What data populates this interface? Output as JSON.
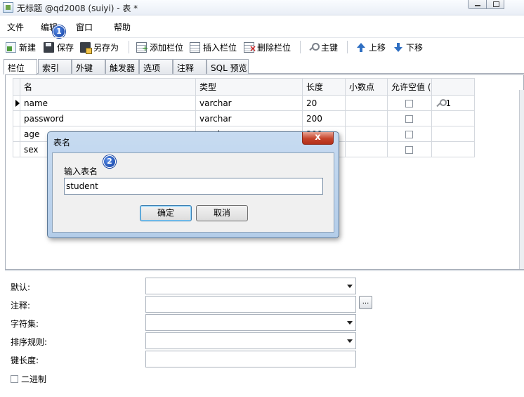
{
  "window": {
    "title": "无标题 @qd2008 (suiyi) - 表 *"
  },
  "menu": [
    "文件",
    "编辑",
    "窗口",
    "帮助"
  ],
  "toolbar": {
    "new": "新建",
    "save": "保存",
    "save_as": "另存为",
    "add_field": "添加栏位",
    "insert_field": "插入栏位",
    "delete_field": "删除栏位",
    "primary_key": "主键",
    "move_up": "上移",
    "move_down": "下移"
  },
  "badges": {
    "first": "1",
    "second": "2"
  },
  "tabs": [
    "栏位",
    "索引",
    "外键",
    "触发器",
    "选项",
    "注释",
    "SQL 预览"
  ],
  "table": {
    "headers": [
      "名",
      "类型",
      "长度",
      "小数点",
      "允许空值 ("
    ],
    "rows": [
      {
        "name": "name",
        "type": "varchar",
        "length": "20",
        "decimals": "",
        "nullable": false,
        "key": "1"
      },
      {
        "name": "password",
        "type": "varchar",
        "length": "200",
        "decimals": "",
        "nullable": false,
        "key": ""
      },
      {
        "name": "age",
        "type": "varchar",
        "length": "200",
        "decimals": "",
        "nullable": false,
        "key": ""
      },
      {
        "name": "sex",
        "type": "",
        "length": "",
        "decimals": "",
        "nullable": false,
        "key": ""
      }
    ]
  },
  "properties": {
    "default": "默认:",
    "comment": "注释:",
    "charset": "字符集:",
    "collation": "排序规则:",
    "key_length": "键长度:",
    "binary": "二进制",
    "browse": "..."
  },
  "dialog": {
    "title": "表名",
    "label": "输入表名",
    "value": "student",
    "ok": "确定",
    "cancel": "取消",
    "close": "x"
  }
}
